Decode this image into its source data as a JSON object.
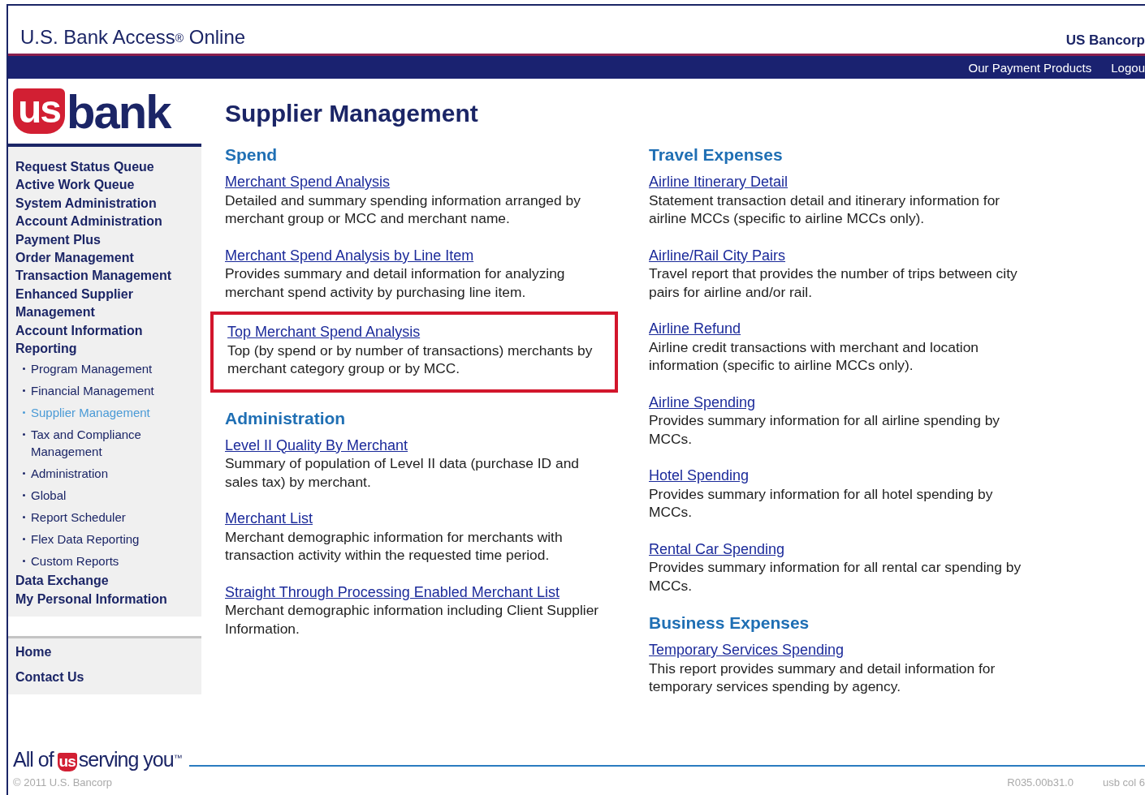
{
  "header": {
    "title": "U.S. Bank Access",
    "title_mark": "®",
    "title_rest": " Online",
    "company": "US Bancorp"
  },
  "navbar": {
    "links": [
      "Our Payment Products",
      "Logou"
    ]
  },
  "logo": {
    "mark": "us",
    "word": "bank"
  },
  "page_title": "Supplier Management",
  "sidebar": {
    "items": [
      {
        "label": "Request Status Queue"
      },
      {
        "label": "Active Work Queue"
      },
      {
        "label": "System Administration"
      },
      {
        "label": "Account Administration"
      },
      {
        "label": "Payment Plus"
      },
      {
        "label": "Order Management"
      },
      {
        "label": "Transaction Management"
      },
      {
        "label": "Enhanced Supplier Management"
      },
      {
        "label": "Account Information"
      },
      {
        "label": "Reporting",
        "children": [
          {
            "label": "Program Management",
            "selected": false
          },
          {
            "label": "Financial Management",
            "selected": false
          },
          {
            "label": "Supplier Management",
            "selected": true
          },
          {
            "label": "Tax and Compliance Management",
            "selected": false
          },
          {
            "label": "Administration",
            "selected": false
          },
          {
            "label": "Global",
            "selected": false
          },
          {
            "label": "Report Scheduler",
            "selected": false
          },
          {
            "label": "Flex Data Reporting",
            "selected": false
          },
          {
            "label": "Custom Reports",
            "selected": false
          }
        ]
      },
      {
        "label": "Data Exchange"
      },
      {
        "label": "My Personal Information"
      }
    ],
    "footer_links": [
      "Home",
      "Contact Us"
    ]
  },
  "columns": [
    {
      "sections": [
        {
          "heading": "Spend",
          "reports": [
            {
              "link": "Merchant Spend Analysis",
              "description": "Detailed and summary spending information arranged by merchant group or MCC and merchant name.",
              "highlighted": false
            },
            {
              "link": "Merchant Spend Analysis by Line Item",
              "description": "Provides summary and detail information for analyzing merchant spend activity by purchasing line item.",
              "highlighted": false
            },
            {
              "link": "Top Merchant Spend Analysis",
              "description": "Top (by spend or by number of transactions) merchants by merchant category group or by MCC.",
              "highlighted": true
            }
          ]
        },
        {
          "heading": "Administration",
          "reports": [
            {
              "link": "Level II Quality By Merchant",
              "description": "Summary of population of Level II data (purchase ID and sales tax) by merchant.",
              "highlighted": false
            },
            {
              "link": "Merchant List",
              "description": "Merchant demographic information for merchants with transaction activity within the requested time period.",
              "highlighted": false
            },
            {
              "link": "Straight Through Processing Enabled Merchant List",
              "description": "Merchant demographic information including Client Supplier Information.",
              "highlighted": false
            }
          ]
        }
      ]
    },
    {
      "sections": [
        {
          "heading": "Travel Expenses",
          "reports": [
            {
              "link": "Airline Itinerary Detail",
              "description": "Statement transaction detail and itinerary information for airline MCCs (specific to airline MCCs only).",
              "highlighted": false
            },
            {
              "link": "Airline/Rail City Pairs",
              "description": "Travel report that provides the number of trips between city pairs for airline and/or rail.",
              "highlighted": false
            },
            {
              "link": "Airline Refund",
              "description": "Airline credit transactions with merchant and location information (specific to airline MCCs only).",
              "highlighted": false
            },
            {
              "link": "Airline Spending",
              "description": "Provides summary information for all airline spending by MCCs.",
              "highlighted": false
            },
            {
              "link": "Hotel Spending",
              "description": "Provides summary information for all hotel spending by MCCs.",
              "highlighted": false
            },
            {
              "link": "Rental Car Spending",
              "description": "Provides summary information for all rental car spending by MCCs.",
              "highlighted": false
            }
          ]
        },
        {
          "heading": "Business Expenses",
          "reports": [
            {
              "link": "Temporary Services Spending",
              "description": "This report provides summary and detail information for temporary services spending by agency.",
              "highlighted": false
            }
          ]
        }
      ]
    }
  ],
  "footer": {
    "slogan_start": "All of",
    "slogan_mark": "us",
    "slogan_end": "serving you",
    "slogan_tm": "™",
    "copyright": "© 2011 U.S. Bancorp",
    "version": "R035.00b31.0",
    "server": "usb col 6"
  }
}
